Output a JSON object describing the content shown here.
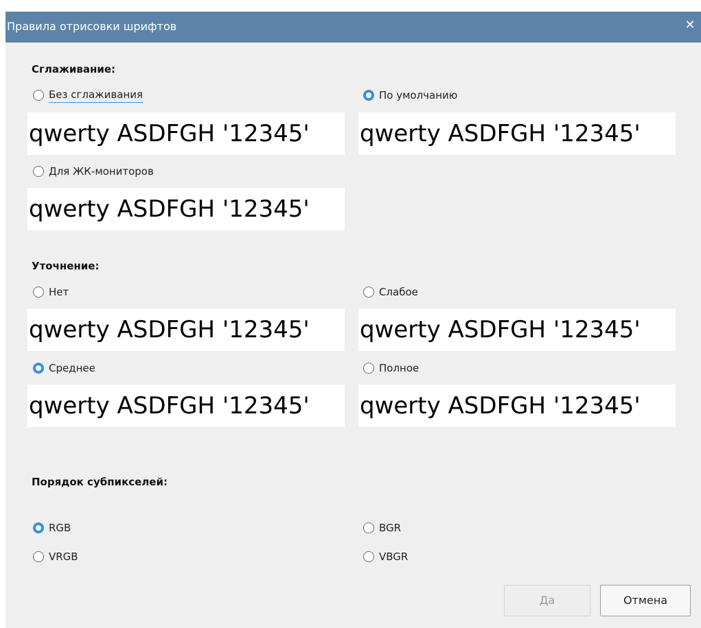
{
  "dialog": {
    "title": "Правила отрисовки шрифтов",
    "close_glyph": "✕"
  },
  "sample_text": "qwerty ASDFGH '12345'",
  "antialiasing": {
    "label": "Сглаживание:",
    "options": [
      {
        "label": "Без сглаживания",
        "checked": false
      },
      {
        "label": "По умолчанию",
        "checked": true
      },
      {
        "label": "Для ЖК-мониторов",
        "checked": false
      }
    ]
  },
  "hinting": {
    "label": "Уточнение:",
    "options": [
      {
        "label": "Нет",
        "checked": false
      },
      {
        "label": "Слабое",
        "checked": false
      },
      {
        "label": "Среднее",
        "checked": true
      },
      {
        "label": "Полное",
        "checked": false
      }
    ]
  },
  "subpixel": {
    "label": "Порядок субпикселей:",
    "options": [
      {
        "label": "RGB",
        "checked": true
      },
      {
        "label": "BGR",
        "checked": false
      },
      {
        "label": "VRGB",
        "checked": false
      },
      {
        "label": "VBGR",
        "checked": false
      }
    ]
  },
  "buttons": {
    "ok": "Да",
    "cancel": "Отмена"
  },
  "colors": {
    "titlebar": "#5b84a8",
    "accent": "#3b8fd9",
    "background": "#efefef"
  }
}
